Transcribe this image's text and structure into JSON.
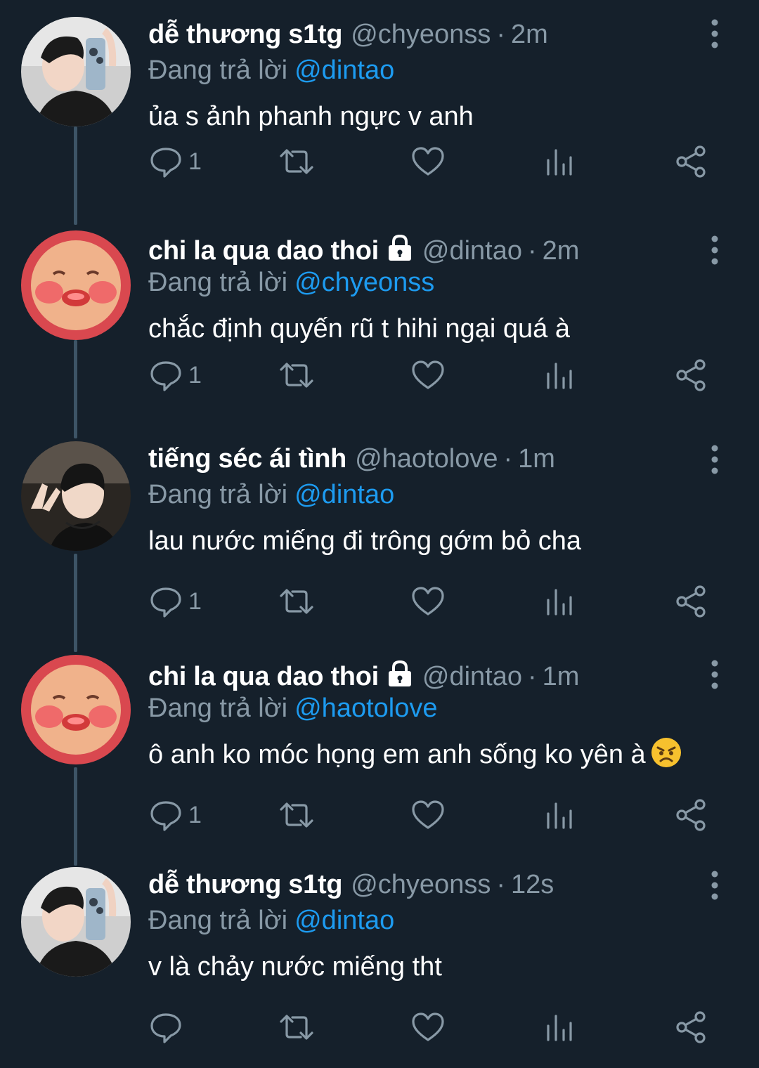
{
  "colors": {
    "background": "#15202b",
    "thread_line": "#3d5466",
    "text_primary": "#ffffff",
    "text_secondary": "#8899a6",
    "mention": "#1d9bf0"
  },
  "tweets": [
    {
      "name": "dễ thương s1tg",
      "handle": "@chyeonss",
      "separator": "·",
      "time": "2m",
      "reply_prefix": "Đang trả lời",
      "reply_to": "@dintao",
      "text": "ủa s ảnh phanh ngực v anh",
      "reply_count": "1",
      "locked": false,
      "avatar": "boy-selfie-avatar"
    },
    {
      "name": "chi la qua dao thoi",
      "handle": "@dintao",
      "separator": "·",
      "time": "2m",
      "reply_prefix": "Đang trả lời",
      "reply_to": "@chyeonss",
      "text": "chắc định quyến rũ t hihi ngại quá à",
      "reply_count": "1",
      "locked": true,
      "avatar": "peach-face-avatar"
    },
    {
      "name": "tiếng séc ái tình",
      "handle": "@haotolove",
      "separator": "·",
      "time": "1m",
      "reply_prefix": "Đang trả lời",
      "reply_to": "@dintao",
      "text": "lau nước miếng đi trông gớm bỏ cha",
      "reply_count": "1",
      "locked": false,
      "avatar": "boy-peace-avatar"
    },
    {
      "name": "chi la qua dao thoi",
      "handle": "@dintao",
      "separator": "·",
      "time": "1m",
      "reply_prefix": "Đang trả lời",
      "reply_to": "@haotolove",
      "text": "ô anh ko móc họng em anh sống ko yên à",
      "reply_count": "1",
      "locked": true,
      "emoji": "angry-face-emoji",
      "avatar": "peach-face-avatar"
    },
    {
      "name": "dễ thương s1tg",
      "handle": "@chyeonss",
      "separator": "·",
      "time": "12s",
      "reply_prefix": "Đang trả lời",
      "reply_to": "@dintao",
      "text": "v là chảy nước miếng tht",
      "reply_count": "",
      "locked": false,
      "avatar": "boy-selfie-avatar"
    }
  ],
  "icons": {
    "reply": "reply-icon",
    "retweet": "retweet-icon",
    "like": "heart-icon",
    "views": "analytics-icon",
    "share": "share-icon",
    "more": "more-vertical-icon",
    "lock": "lock-icon"
  }
}
